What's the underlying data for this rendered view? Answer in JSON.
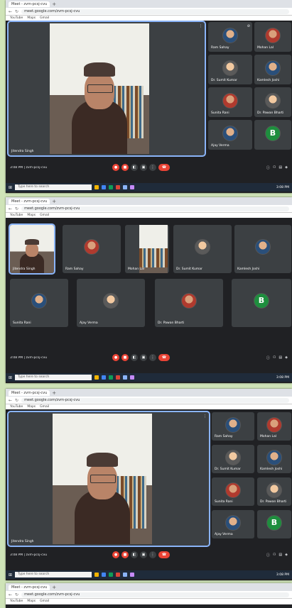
{
  "browser": {
    "tab_title": "Meet - zvm-pcsj-cvu",
    "url": "meet.google.com/zvm-pcsj-cvu",
    "bookmarks": [
      "YouTube",
      "Maps",
      "Gmail"
    ]
  },
  "meeting": {
    "info": "3:08 PM | zvm-pcsj-cvu",
    "main_speaker": "Jitendra Singh",
    "participants": [
      {
        "name": "Ram Sahay",
        "avatar": "c"
      },
      {
        "name": "Mohan Lal",
        "avatar": "d"
      },
      {
        "name": "Dr. Sumit Kumar",
        "avatar": "e"
      },
      {
        "name": "Kamlesh Joshi",
        "avatar": "c"
      },
      {
        "name": "Sunita Rani",
        "avatar": "d"
      },
      {
        "name": "Dr. Pawan Bharti",
        "avatar": "e"
      },
      {
        "name": "Ajay Verma",
        "avatar": "c"
      },
      {
        "name": "B",
        "avatar": "b"
      }
    ],
    "grid_names": [
      "Jitendra Singh",
      "Ram Sahay",
      "Mohan Lal",
      "Dr. Sumit Kumar",
      "Kamlesh Joshi",
      "Sunita Rani",
      "Ajay Verma",
      "Dr. Pawan Bharti",
      "B"
    ]
  },
  "controls": {
    "mic": "mic-icon",
    "cam": "cam-icon",
    "cc": "captions-icon",
    "present": "present-icon",
    "more": "more-icon",
    "leave": "leave-call-icon"
  },
  "taskbar": {
    "search_placeholder": "Type here to search",
    "clock": "3:08 PM"
  }
}
